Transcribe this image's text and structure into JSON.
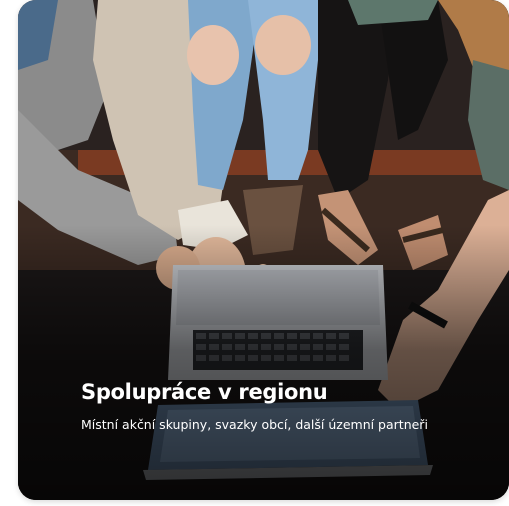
{
  "card": {
    "title": "Spolupráce v regionu",
    "subtitle": "Místní akční skupiny, svazky obcí, další územní partneři"
  }
}
